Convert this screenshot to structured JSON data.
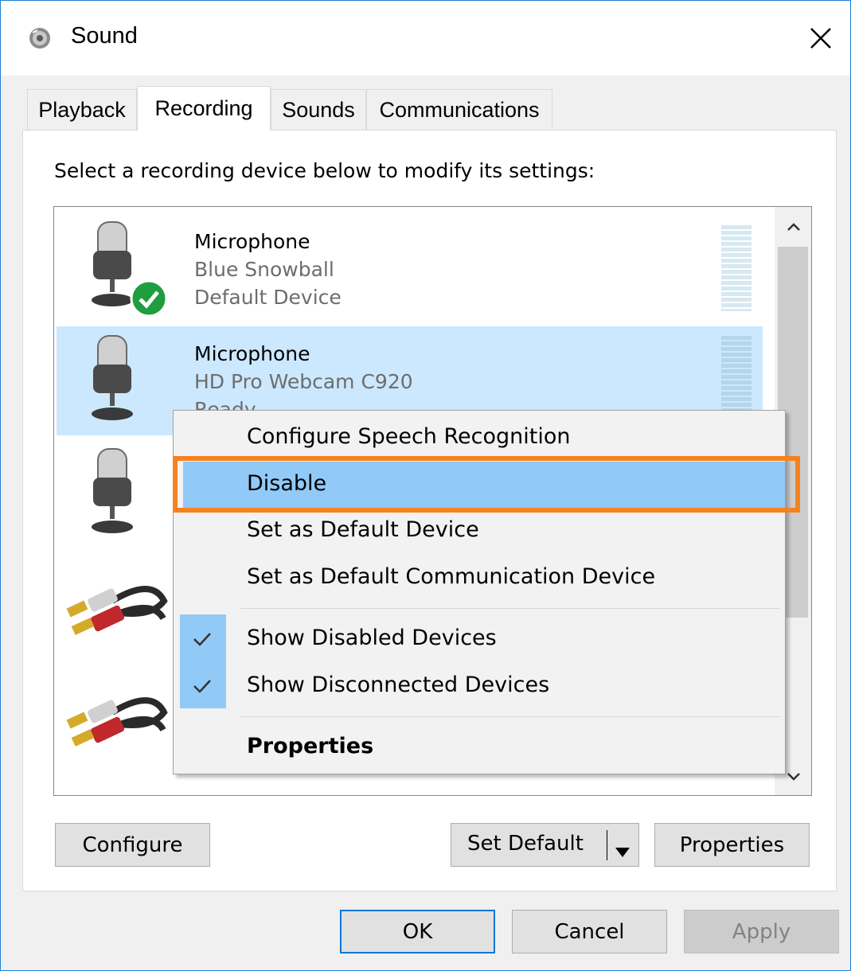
{
  "window": {
    "title": "Sound",
    "icon": "speaker-icon",
    "close": "close-icon"
  },
  "tabs": [
    {
      "label": "Playback",
      "active": false
    },
    {
      "label": "Recording",
      "active": true
    },
    {
      "label": "Sounds",
      "active": false
    },
    {
      "label": "Communications",
      "active": false
    }
  ],
  "instruction": "Select a recording device below to modify its settings:",
  "devices": [
    {
      "name": "Microphone",
      "detail": "Blue Snowball",
      "status": "Default Device",
      "icon": "microphone-icon",
      "default_badge": "green-check-icon",
      "selected": false
    },
    {
      "name": "Microphone",
      "detail": "HD Pro Webcam C920",
      "status": "Ready",
      "icon": "microphone-icon",
      "selected": true
    },
    {
      "name": "",
      "detail": "",
      "status": "",
      "icon": "microphone-icon",
      "selected": false
    },
    {
      "name": "",
      "detail": "",
      "status": "",
      "icon": "rca-cable-icon",
      "selected": false
    },
    {
      "name": "",
      "detail": "",
      "status": "",
      "icon": "rca-cable-icon",
      "selected": false
    }
  ],
  "context_menu": {
    "items": [
      {
        "label": "Configure Speech Recognition"
      },
      {
        "label": "Disable",
        "highlighted": true
      },
      {
        "label": "Set as Default Device"
      },
      {
        "label": "Set as Default Communication Device"
      },
      {
        "label": "Show Disabled Devices",
        "checked": true
      },
      {
        "label": "Show Disconnected Devices",
        "checked": true
      },
      {
        "label": "Properties",
        "bold": true
      }
    ],
    "annotation_color": "#f5821f",
    "highlight_color": "#91c9f7"
  },
  "buttons": {
    "configure": "Configure",
    "set_default": "Set Default",
    "properties": "Properties",
    "ok": "OK",
    "cancel": "Cancel",
    "apply": "Apply"
  },
  "colors": {
    "selection": "#cce8ff",
    "accent": "#0078d7",
    "default_check": "#1e9e3e"
  }
}
